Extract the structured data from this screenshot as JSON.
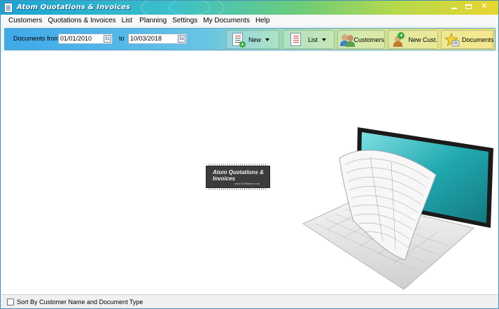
{
  "window": {
    "title": "Atom Quotations & Invoices"
  },
  "menu": [
    "Customers",
    "Quotations & Invoices",
    "List",
    "Planning",
    "Settings",
    "My Documents",
    "Help"
  ],
  "toolbar": {
    "from_label": "Documents from:",
    "from_value": "01/01/2010",
    "to_label": "to",
    "to_value": "10/03/2018",
    "calendar_glyph": "31",
    "new_label": "New",
    "list_label": "List",
    "customers_label": "Customers",
    "new_cust_label": "New Cust.",
    "documents_label": "Documents"
  },
  "logo": {
    "title": "Atom Quotations & Invoices",
    "url": "www.SoftMaker.com"
  },
  "status": {
    "sort_label": "Sort By Customer Name and Document Type",
    "sort_checked": false
  },
  "colors": {
    "title_gradient_start": "#1aa3d4",
    "title_gradient_end": "#e9d52f",
    "screen_teal": "#1f9fa6"
  },
  "icons": {
    "new": "document-plus-icon",
    "list": "list-document-icon",
    "customers": "people-icon",
    "new_cust": "add-person-icon",
    "documents": "star-folder-icon"
  }
}
